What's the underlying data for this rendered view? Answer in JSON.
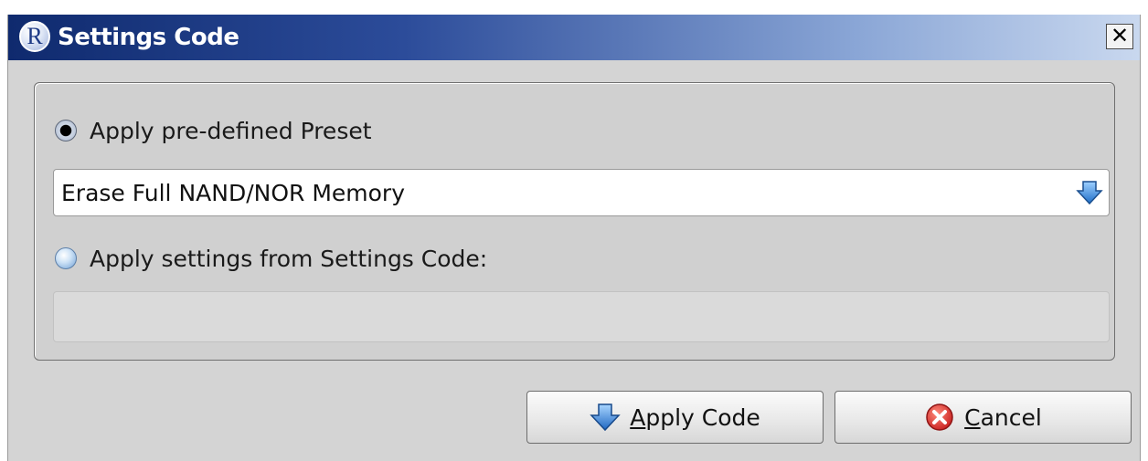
{
  "window": {
    "title": "Settings Code",
    "logo_letter": "R",
    "close_glyph": "✕"
  },
  "options": {
    "preset": {
      "label": "Apply pre-defined Preset",
      "checked": true
    },
    "preset_combo": {
      "value": "Erase Full NAND/NOR Memory",
      "arrow_icon": "chevron-down-icon"
    },
    "code": {
      "label": "Apply settings from Settings Code:",
      "checked": false
    },
    "code_field": {
      "value": ""
    }
  },
  "buttons": {
    "apply": {
      "mnemonic": "A",
      "rest": "pply Code",
      "icon": "arrow-down-icon"
    },
    "cancel": {
      "mnemonic": "C",
      "rest": "ancel",
      "icon": "cancel-icon"
    }
  },
  "colors": {
    "title_gradient_start": "#0f2a6e",
    "title_gradient_end": "#c9d8ef",
    "accent_blue": "#2f7fd6",
    "cancel_red": "#d62b2b"
  }
}
